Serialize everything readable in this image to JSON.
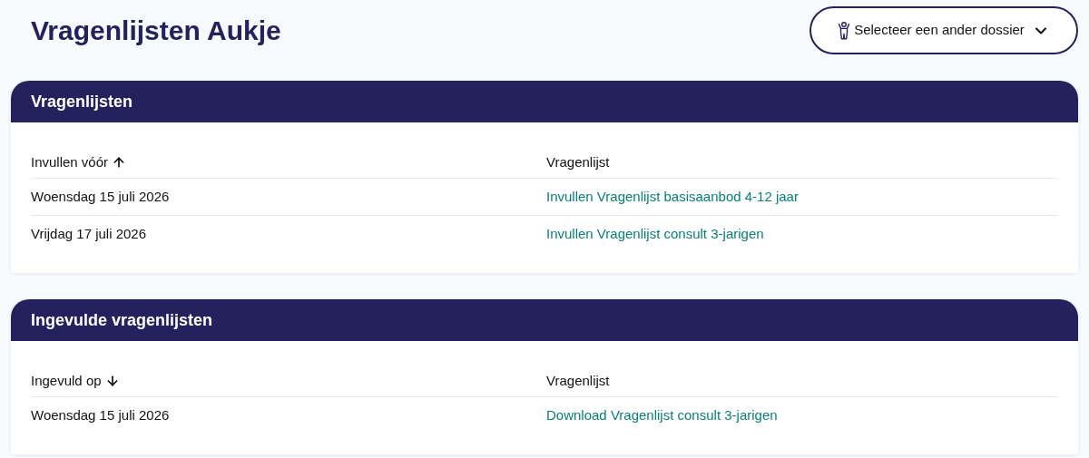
{
  "page_title": "Vragenlijsten Aukje",
  "dossier_button": {
    "label": "Selecteer een ander dossier"
  },
  "sections": [
    {
      "title": "Vragenlijsten",
      "columns": [
        {
          "label": "Invullen vóór",
          "sorted": true,
          "ascending": true
        },
        {
          "label": "Vragenlijst",
          "sorted": false
        }
      ],
      "rows": [
        {
          "date": "Woensdag 15 juli 2026",
          "link": "Invullen Vragenlijst basisaanbod 4-12 jaar"
        },
        {
          "date": "Vrijdag 17 juli 2026",
          "link": "Invullen Vragenlijst consult 3-jarigen"
        }
      ]
    },
    {
      "title": "Ingevulde vragenlijsten",
      "columns": [
        {
          "label": "Ingevuld op",
          "sorted": true,
          "ascending": false
        },
        {
          "label": "Vragenlijst",
          "sorted": false
        }
      ],
      "rows": [
        {
          "date": "Woensdag 15 juli 2026",
          "link": "Download Vragenlijst consult 3-jarigen"
        }
      ]
    }
  ]
}
